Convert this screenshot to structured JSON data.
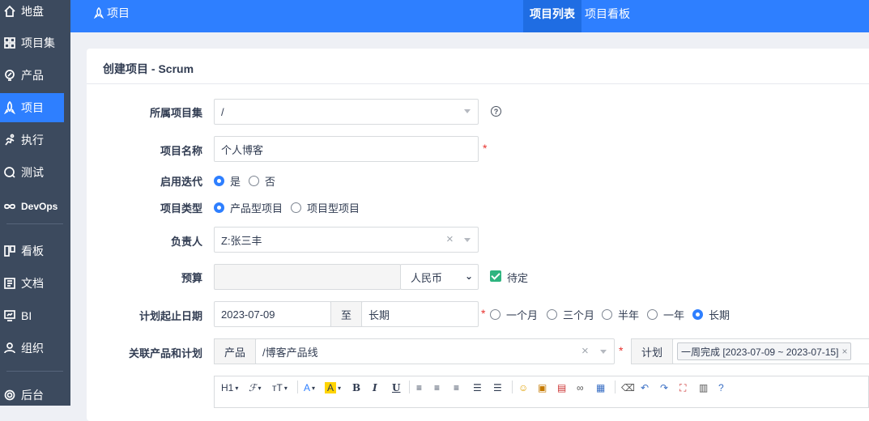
{
  "sidebar": {
    "items": [
      {
        "label": "地盘",
        "icon": "home-icon"
      },
      {
        "label": "项目集",
        "icon": "grid-icon"
      },
      {
        "label": "产品",
        "icon": "bulb-icon"
      },
      {
        "label": "项目",
        "icon": "rocket-icon"
      },
      {
        "label": "执行",
        "icon": "run-icon"
      },
      {
        "label": "测试",
        "icon": "test-icon"
      },
      {
        "label": "DevOps",
        "icon": "infinity-icon"
      },
      {
        "label": "看板",
        "icon": "board-icon"
      },
      {
        "label": "文档",
        "icon": "doc-icon"
      },
      {
        "label": "BI",
        "icon": "monitor-icon"
      },
      {
        "label": "组织",
        "icon": "user-icon"
      },
      {
        "label": "后台",
        "icon": "gear-icon"
      }
    ]
  },
  "topbar": {
    "title": "项目",
    "tabs": [
      {
        "label": "项目列表"
      },
      {
        "label": "项目看板"
      }
    ]
  },
  "form": {
    "heading": "创建项目 - Scrum",
    "program": {
      "label": "所属项目集",
      "value": "/"
    },
    "name": {
      "label": "项目名称",
      "value": "个人博客"
    },
    "iteration": {
      "label": "启用迭代",
      "options": [
        "是",
        "否"
      ],
      "selected": "是"
    },
    "type": {
      "label": "项目类型",
      "options": [
        "产品型项目",
        "项目型项目"
      ],
      "selected": "产品型项目"
    },
    "owner": {
      "label": "负责人",
      "value": "Z:张三丰"
    },
    "budget": {
      "label": "预算",
      "value": "",
      "currency": "人民币",
      "pending_label": "待定",
      "pending_checked": true
    },
    "dates": {
      "label": "计划起止日期",
      "begin": "2023-07-09",
      "to": "至",
      "end": "长期",
      "options": [
        "一个月",
        "三个月",
        "半年",
        "一年",
        "长期"
      ],
      "selected": "长期"
    },
    "products": {
      "label": "关联产品和计划",
      "product_addon": "产品",
      "product_value": "/博客产品线",
      "plan_addon": "计划",
      "plan_value": "一周完成 [2023-07-09 ~ 2023-07-15]"
    }
  },
  "editor_toolbar": {
    "heading": "H1",
    "font": "ℱ",
    "size": "тT",
    "font_color": "A",
    "bg_color": "A",
    "bold": "B",
    "italic": "I",
    "underline": "U"
  },
  "colors": {
    "accent": "#2e7fff",
    "sidebar": "#3c4a5e",
    "required": "#e8322e",
    "check": "#2eb47f"
  }
}
